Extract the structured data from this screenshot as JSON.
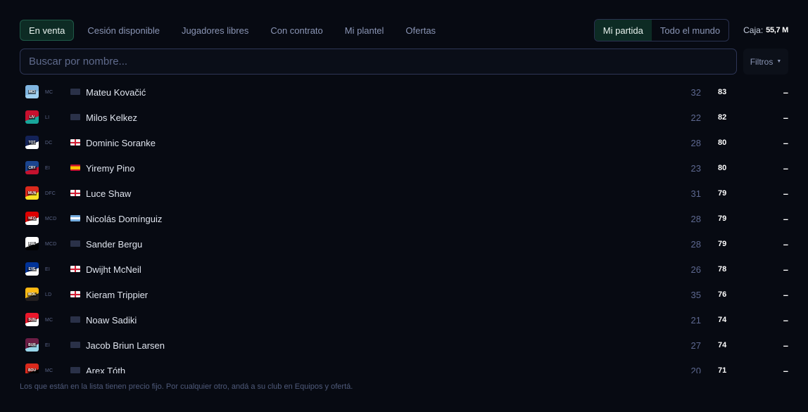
{
  "tabs": [
    {
      "label": "En venta",
      "active": true
    },
    {
      "label": "Cesión disponible",
      "active": false
    },
    {
      "label": "Jugadores libres",
      "active": false
    },
    {
      "label": "Con contrato",
      "active": false
    },
    {
      "label": "Mi plantel",
      "active": false
    },
    {
      "label": "Ofertas",
      "active": false
    }
  ],
  "scope": {
    "mine_label": "Mi partida",
    "world_label": "Todo el mundo",
    "selected": "Mi partida"
  },
  "cash": {
    "label": "Caja:",
    "value": "55,7 M"
  },
  "search": {
    "placeholder": "Buscar por nombre...",
    "value": ""
  },
  "filters": {
    "label": "Filtros",
    "icon": "caret-down-icon"
  },
  "players": [
    {
      "club": "MCI",
      "colors": [
        "#7fb5e0",
        "#9fd0f0"
      ],
      "pos": "MC",
      "flag": "none",
      "name": "Mateu Kovačić",
      "age": "32",
      "ovr": "83",
      "price": "–"
    },
    {
      "club": "LIV",
      "colors": [
        "#c8102e",
        "#18a69b"
      ],
      "pos": "LI",
      "flag": "none",
      "name": "Milos Kelkez",
      "age": "22",
      "ovr": "82",
      "price": "–"
    },
    {
      "club": "TOT",
      "colors": [
        "#132257",
        "#ffffff"
      ],
      "pos": "DC",
      "flag": "eng",
      "name": "Dominic Soranke",
      "age": "28",
      "ovr": "80",
      "price": "–"
    },
    {
      "club": "CRY",
      "colors": [
        "#1b458f",
        "#c4122e"
      ],
      "pos": "EI",
      "flag": "esp",
      "name": "Yiremy Pino",
      "age": "23",
      "ovr": "80",
      "price": "–"
    },
    {
      "club": "MUN",
      "colors": [
        "#da291c",
        "#fbe122"
      ],
      "pos": "DFC",
      "flag": "eng",
      "name": "Luce Shaw",
      "age": "31",
      "ovr": "79",
      "price": "–"
    },
    {
      "club": "NFO",
      "colors": [
        "#dd0000",
        "#ffffff"
      ],
      "pos": "MCD",
      "flag": "arg",
      "name": "Nicolás Domínguiz",
      "age": "28",
      "ovr": "79",
      "price": "–"
    },
    {
      "club": "FUL",
      "colors": [
        "#ffffff",
        "#000000"
      ],
      "pos": "MCD",
      "flag": "none",
      "name": "Sander Bergu",
      "age": "28",
      "ovr": "79",
      "price": "–"
    },
    {
      "club": "EVE",
      "colors": [
        "#003399",
        "#ffffff"
      ],
      "pos": "EI",
      "flag": "eng",
      "name": "Dwijht McNeil",
      "age": "26",
      "ovr": "78",
      "price": "–"
    },
    {
      "club": "WOL",
      "colors": [
        "#fdb913",
        "#231f20"
      ],
      "pos": "LD",
      "flag": "eng",
      "name": "Kieram Trippier",
      "age": "35",
      "ovr": "76",
      "price": "–"
    },
    {
      "club": "SUN",
      "colors": [
        "#eb172b",
        "#ffffff"
      ],
      "pos": "MC",
      "flag": "none",
      "name": "Noaw Sadiki",
      "age": "21",
      "ovr": "74",
      "price": "–"
    },
    {
      "club": "BUR",
      "colors": [
        "#6c1d45",
        "#99d6ea"
      ],
      "pos": "EI",
      "flag": "none",
      "name": "Jacob Briun Larsen",
      "age": "27",
      "ovr": "74",
      "price": "–"
    },
    {
      "club": "BOU",
      "colors": [
        "#da291c",
        "#000000"
      ],
      "pos": "MC",
      "flag": "none",
      "name": "Arex Tóth",
      "age": "20",
      "ovr": "71",
      "price": "–"
    }
  ],
  "footnote": "Los que están en la lista tienen precio fijo. Por cualquier otro, andá a su club en Equipos y ofertá."
}
